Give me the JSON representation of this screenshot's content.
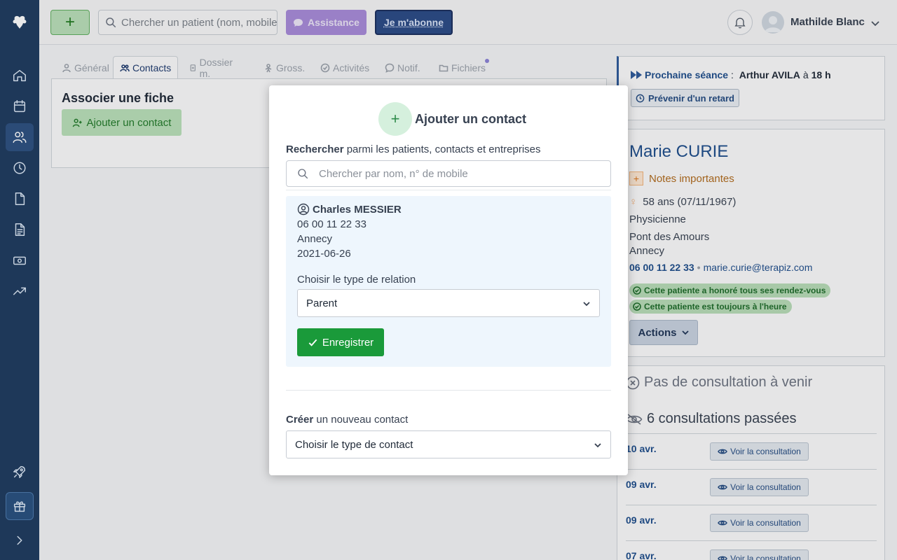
{
  "topbar": {
    "add_label": "+",
    "search_placeholder": "Chercher un patient (nom, mobile)",
    "assist_label": "Assistance",
    "subscribe_label": "Je m'abonne",
    "user_name": "Mathilde Blanc"
  },
  "sidebar": {
    "items": [
      {
        "icon": "home-icon"
      },
      {
        "icon": "calendar-icon"
      },
      {
        "icon": "users-icon",
        "active": true
      },
      {
        "icon": "clock-icon"
      },
      {
        "icon": "file-icon"
      },
      {
        "icon": "document-icon"
      },
      {
        "icon": "money-icon"
      },
      {
        "icon": "trending-icon"
      },
      {
        "icon": "rocket-icon"
      },
      {
        "icon": "gift-icon"
      },
      {
        "icon": "chevron-right-icon"
      }
    ]
  },
  "tabs": [
    {
      "label": "Général"
    },
    {
      "label": "Contacts"
    },
    {
      "label": "Dossier m."
    },
    {
      "label": "Gross."
    },
    {
      "label": "Activités"
    },
    {
      "label": "Notif."
    },
    {
      "label": "Fichiers"
    }
  ],
  "left_panel": {
    "title": "Associer une fiche",
    "add_contact_label": "Ajouter un contact"
  },
  "next_session": {
    "prefix": "Prochaine séance",
    "colon": " : ",
    "patient": "Arthur AVILA",
    "at": "à",
    "time": "18 h",
    "warn_label": "Prévenir d'un retard"
  },
  "patient": {
    "name": "Marie CURIE",
    "notes_label": "Notes importantes",
    "age": "58 ans (07/11/1967)",
    "job": "Physicienne",
    "address_line1": "Pont des Amours",
    "address_line2": "Annecy",
    "phone": "06 00 11 22 33",
    "email": "marie.curie@terapiz.com",
    "badge1": "Cette patiente a honoré tous ses rendez-vous",
    "badge2": "Cette patiente est toujours à l'heure",
    "actions_label": "Actions"
  },
  "consultations": {
    "no_upcoming": "Pas de consultation à venir",
    "past_title": "6 consultations passées",
    "view_label": "Voir la consultation",
    "rows": [
      {
        "date": "10 avr."
      },
      {
        "date": "09 avr."
      },
      {
        "date": "09 avr."
      },
      {
        "date": "07 avr."
      }
    ]
  },
  "modal": {
    "title": "Ajouter un contact",
    "search_bold": "Rechercher",
    "search_rest": " parmi les patients, contacts et entreprises",
    "search_placeholder": "Chercher par nom, n° de mobile",
    "result": {
      "name": "Charles MESSIER",
      "phone": "06 00 11 22 33",
      "city": "Annecy",
      "date": "2021-06-26",
      "relation_label": "Choisir le type de relation",
      "relation_value": "Parent",
      "save_label": "Enregistrer"
    },
    "create_bold": "Créer",
    "create_rest": " un nouveau contact",
    "contact_type_value": "Choisir le type de contact"
  },
  "colors": {
    "sidebar_bg": "#1e3a5f",
    "accent_blue": "#1e4d8c",
    "success_green": "#1a9a3a",
    "assist_purple": "#a78bda"
  }
}
